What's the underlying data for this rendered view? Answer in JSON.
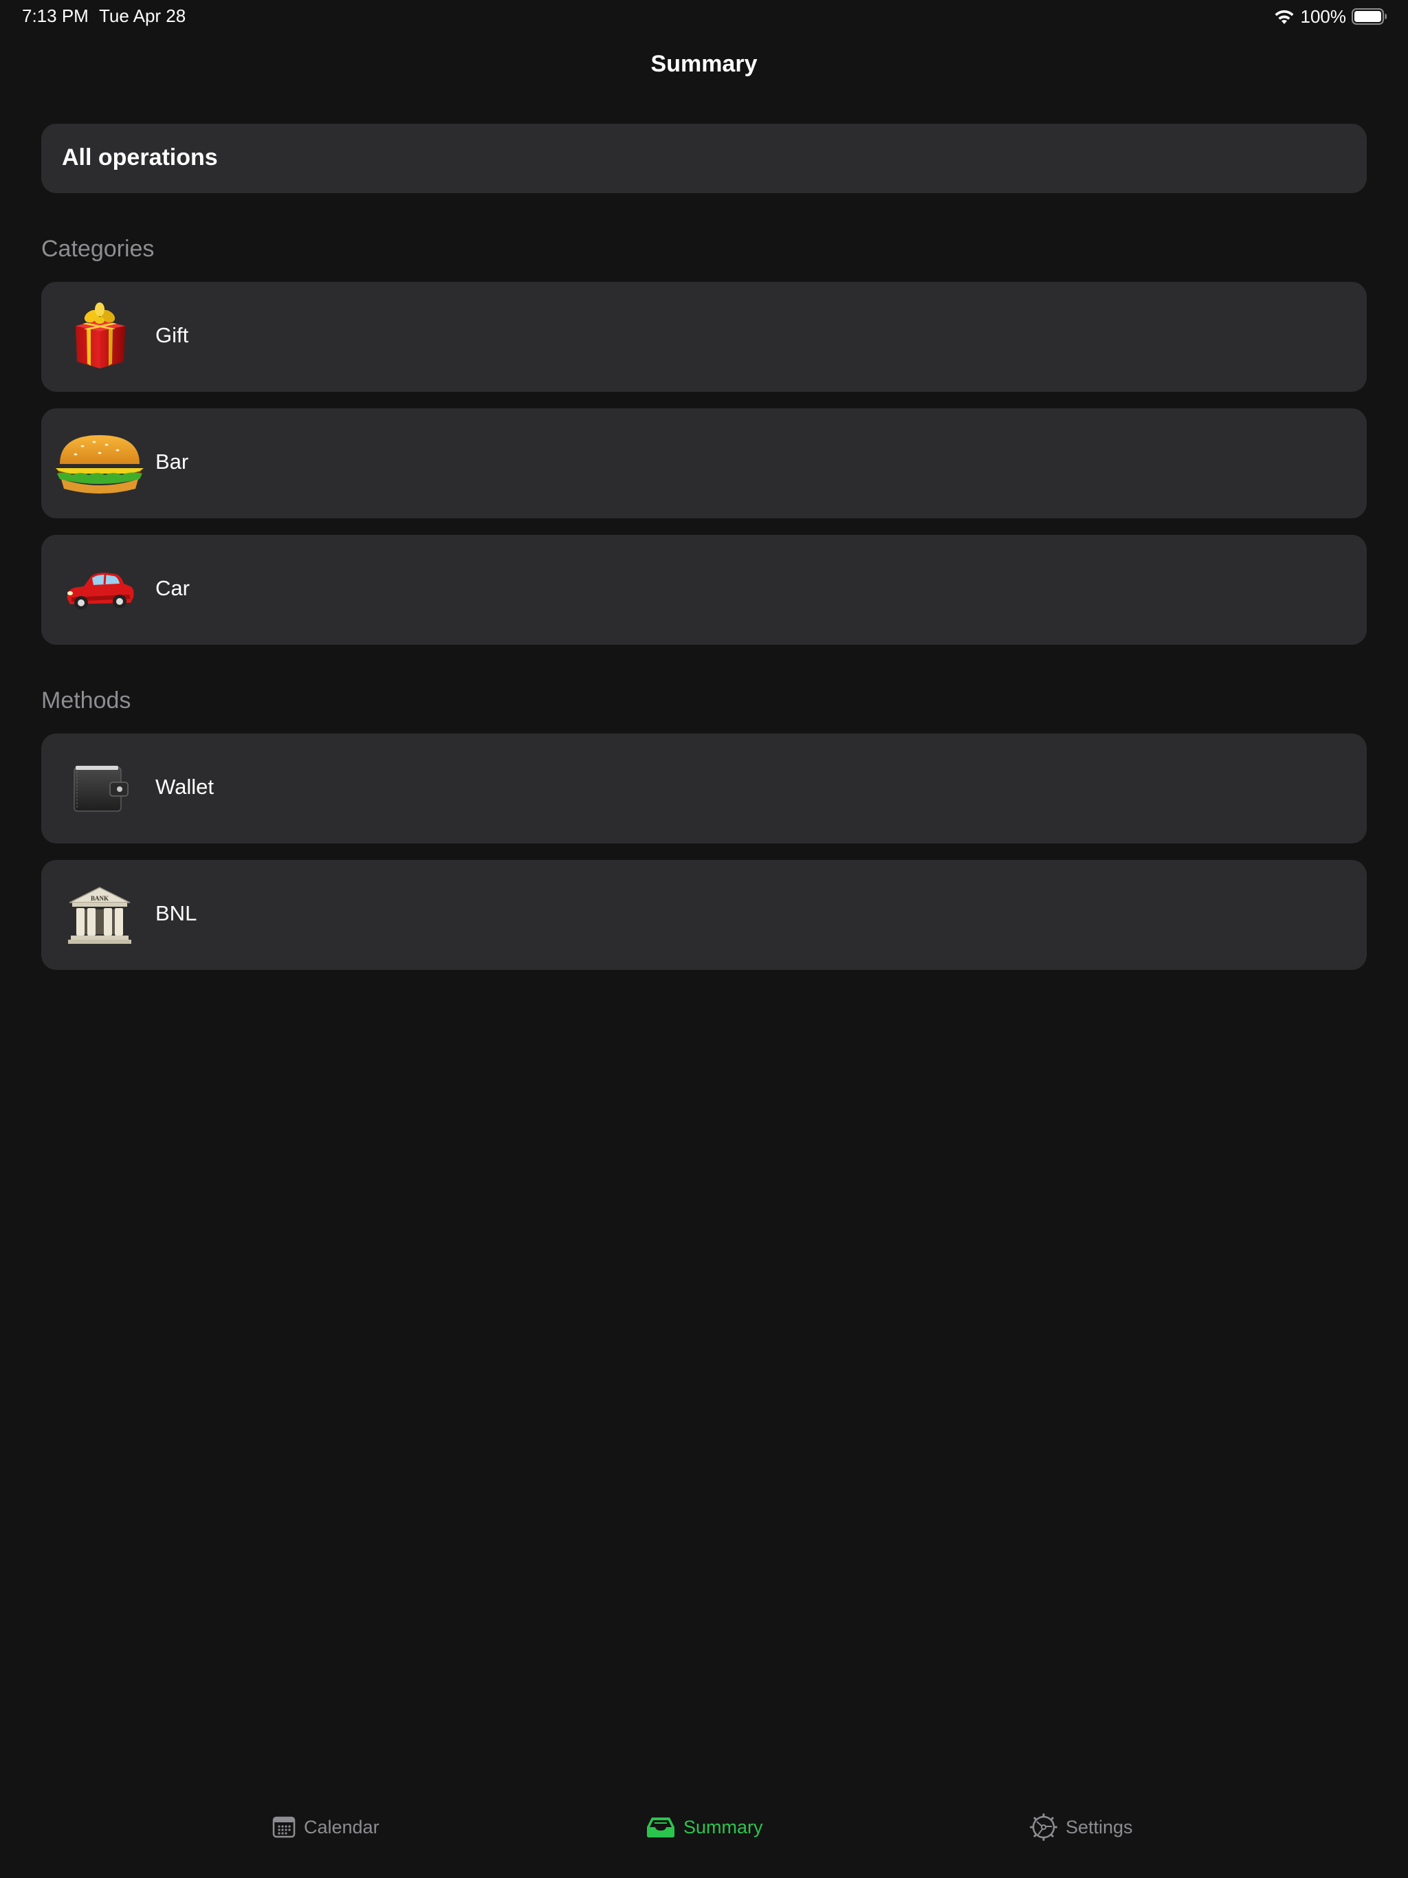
{
  "status_bar": {
    "time": "7:13 PM",
    "date": "Tue Apr 28",
    "battery": "100%"
  },
  "nav": {
    "title": "Summary"
  },
  "all_operations": {
    "label": "All operations"
  },
  "categories": {
    "header": "Categories",
    "items": [
      {
        "label": "Gift",
        "icon": "gift-icon"
      },
      {
        "label": "Bar",
        "icon": "burger-icon"
      },
      {
        "label": "Car",
        "icon": "car-icon"
      }
    ]
  },
  "methods": {
    "header": "Methods",
    "items": [
      {
        "label": "Wallet",
        "icon": "wallet-icon"
      },
      {
        "label": "BNL",
        "icon": "bank-icon",
        "icon_text": "BANK"
      }
    ]
  },
  "tab_bar": {
    "tabs": [
      {
        "label": "Calendar",
        "icon": "calendar-icon",
        "active": false
      },
      {
        "label": "Summary",
        "icon": "tray-icon",
        "active": true
      },
      {
        "label": "Settings",
        "icon": "gear-icon",
        "active": false
      }
    ]
  },
  "colors": {
    "background": "#131313",
    "card": "#2c2c2e",
    "secondary_text": "#8d8d92",
    "accent": "#2bc54e"
  }
}
